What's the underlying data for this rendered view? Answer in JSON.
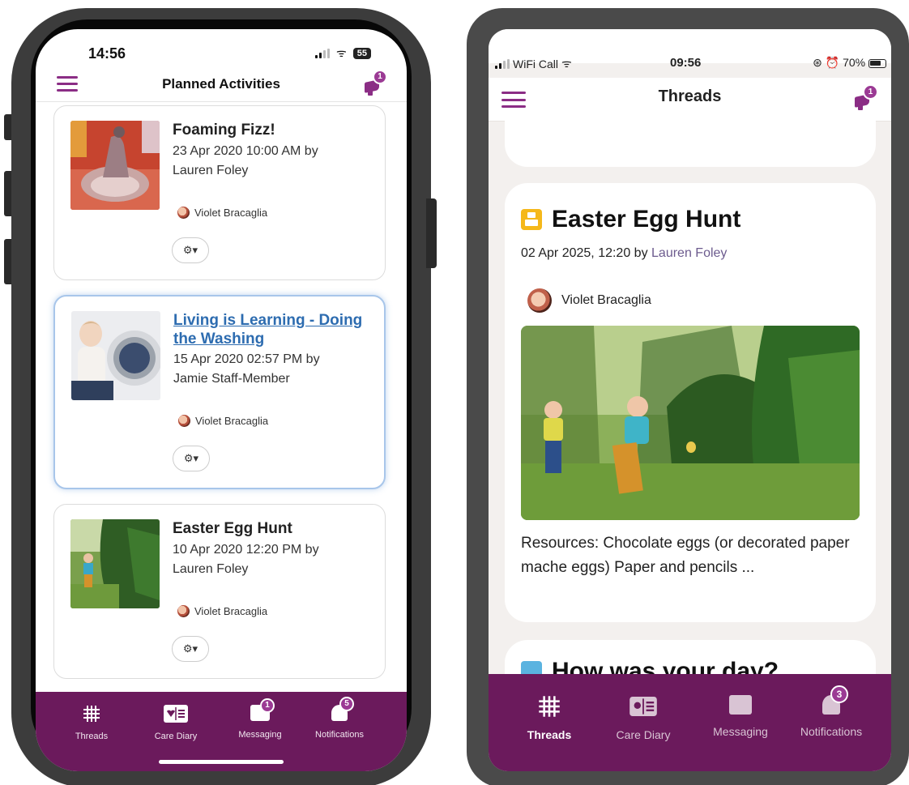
{
  "colors": {
    "brand_purple": "#6b1a5c",
    "accent_magenta": "#8b2d85",
    "link_blue": "#2d6cb0",
    "event_yellow": "#f5b81a"
  },
  "phone1": {
    "status": {
      "time": "14:56",
      "battery": "55"
    },
    "header": {
      "title": "Planned Activities",
      "menu_icon": "hamburger-icon",
      "announce_icon": "megaphone-icon",
      "announce_badge": "1"
    },
    "activities": [
      {
        "title": "Foaming Fizz!",
        "meta_line1": "23 Apr 2020 10:00 AM by",
        "meta_line2": "Lauren Foley",
        "child": "Violet Bracaglia",
        "selected": false
      },
      {
        "title": "Living is Learning - Doing the Washing",
        "meta_line1": "15 Apr 2020 02:57 PM by",
        "meta_line2": "Jamie Staff-Member",
        "child": "Violet Bracaglia",
        "selected": true
      },
      {
        "title": "Easter Egg Hunt",
        "meta_line1": "10 Apr 2020 12:20 PM by",
        "meta_line2": "Lauren Foley",
        "child": "Violet Bracaglia",
        "selected": false
      }
    ],
    "gear_glyph": "⚙▾",
    "tabs": [
      {
        "label": "Threads",
        "icon": "grid-icon",
        "badge": ""
      },
      {
        "label": "Care Diary",
        "icon": "diary-icon",
        "badge": ""
      },
      {
        "label": "Messaging",
        "icon": "message-icon",
        "badge": "1"
      },
      {
        "label": "Notifications",
        "icon": "bell-icon",
        "badge": "5"
      }
    ]
  },
  "phone2": {
    "status": {
      "carrier": "WiFi Call",
      "time": "09:56",
      "battery": "70%"
    },
    "header": {
      "title": "Threads",
      "menu_icon": "hamburger-icon",
      "announce_icon": "megaphone-icon",
      "announce_badge": "1"
    },
    "thread": {
      "title": "Easter Egg Hunt",
      "date": "02 Apr 2025",
      "time_by": ", 12:20 by",
      "author": "Lauren Foley",
      "child": "Violet Bracaglia",
      "description": "Resources:  Chocolate eggs (or decorated paper mache eggs)  Paper and pencils ..."
    },
    "next_thread_title": "How was your day?",
    "tabs": [
      {
        "label": "Threads",
        "icon": "grid-icon",
        "badge": "",
        "active": true
      },
      {
        "label": "Care Diary",
        "icon": "diary-icon",
        "badge": "",
        "active": false
      },
      {
        "label": "Messaging",
        "icon": "message-icon",
        "badge": "",
        "active": false
      },
      {
        "label": "Notifications",
        "icon": "bell-icon",
        "badge": "3",
        "active": false
      }
    ]
  }
}
